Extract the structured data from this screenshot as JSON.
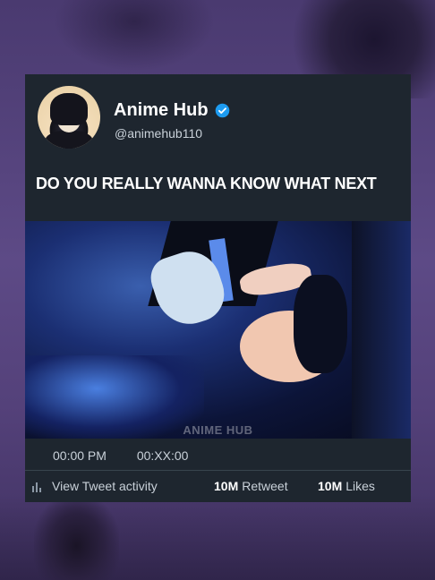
{
  "account": {
    "name": "Anime Hub",
    "handle": "@animehub110"
  },
  "tweet": {
    "text": "DO YOU REALLY WANNA KNOW WHAT NEXT",
    "media_watermark": "ANIME HUB"
  },
  "meta": {
    "time": "00:00 PM",
    "date": "00:XX:00"
  },
  "stats": {
    "activity_label": "View Tweet activity",
    "retweet_count": "10M",
    "retweet_label": "Retweet",
    "likes_count": "10M",
    "likes_label": "Likes"
  },
  "colors": {
    "card_background": "#1e262f",
    "verified_badge": "#1d9bf0",
    "background": "#5d4a86"
  },
  "icons": {
    "verified": "verified-badge-icon",
    "activity": "bar-chart-icon"
  }
}
